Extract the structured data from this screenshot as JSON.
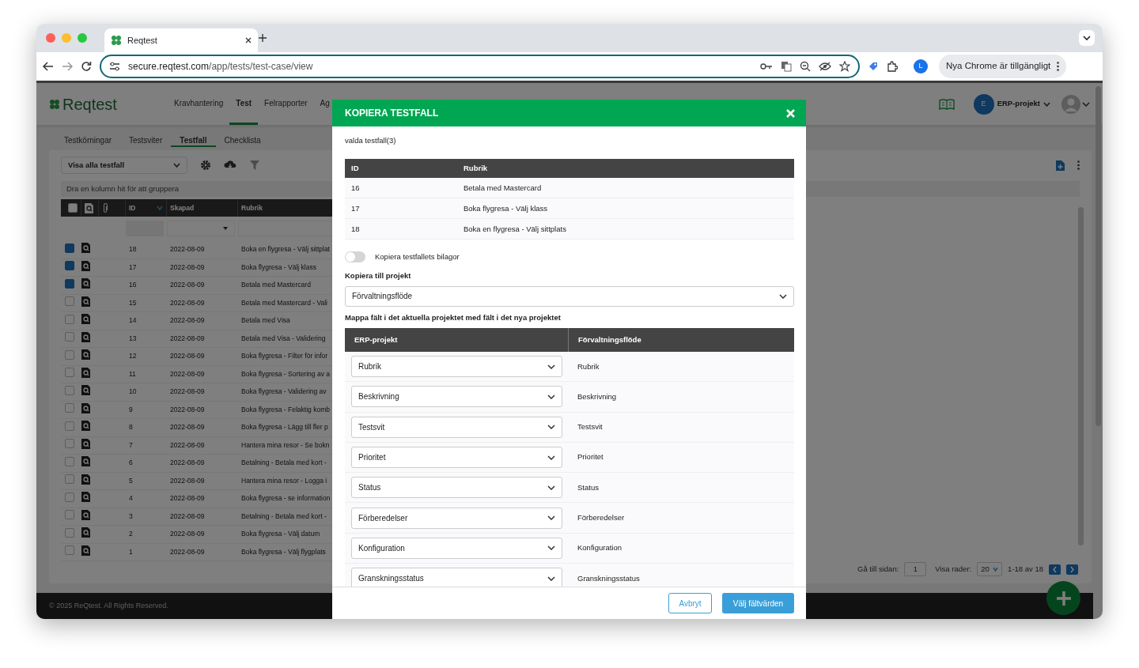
{
  "browser": {
    "tab_title": "Reqtest",
    "url_host": "secure.reqtest.com",
    "url_path": "/app/tests/test-case/view",
    "profile_initial": "L",
    "update_button": "Nya Chrome är tillgängligt"
  },
  "app": {
    "logo": "Reqtest",
    "nav": [
      {
        "label": "Kravhantering",
        "selected": false
      },
      {
        "label": "Test",
        "selected": true
      },
      {
        "label": "Felrapporter",
        "selected": false
      },
      {
        "label": "Ag",
        "selected": false
      }
    ],
    "project": {
      "initial": "E",
      "name": "ERP-projekt"
    },
    "subtabs": [
      {
        "label": "Testkörningar",
        "selected": false
      },
      {
        "label": "Testsviter",
        "selected": false
      },
      {
        "label": "Testfall",
        "selected": true
      },
      {
        "label": "Checklista",
        "selected": false
      }
    ],
    "view_select": "Visa alla testfall",
    "group_hint": "Dra en kolumn hit för att gruppera",
    "columns": [
      "ID",
      "Skapad",
      "Rubrik"
    ],
    "all_selected": false,
    "rows": [
      {
        "selected": true,
        "id": "18",
        "created": "2022-08-09",
        "title": "Boka en flygresa - Välj sittplat"
      },
      {
        "selected": true,
        "id": "17",
        "created": "2022-08-09",
        "title": "Boka flygresa - Välj klass"
      },
      {
        "selected": true,
        "id": "16",
        "created": "2022-08-09",
        "title": "Betala med Mastercard"
      },
      {
        "selected": false,
        "id": "15",
        "created": "2022-08-09",
        "title": "Betala med Mastercard - Vali"
      },
      {
        "selected": false,
        "id": "14",
        "created": "2022-08-09",
        "title": "Betala med Visa"
      },
      {
        "selected": false,
        "id": "13",
        "created": "2022-08-09",
        "title": "Betala med Visa - Validering"
      },
      {
        "selected": false,
        "id": "12",
        "created": "2022-08-09",
        "title": "Boka flygresa - Filter för infor"
      },
      {
        "selected": false,
        "id": "11",
        "created": "2022-08-09",
        "title": "Boka flygresa - Sortering av a"
      },
      {
        "selected": false,
        "id": "10",
        "created": "2022-08-09",
        "title": "Boka flygresa - Validering av"
      },
      {
        "selected": false,
        "id": "9",
        "created": "2022-08-09",
        "title": "Boka flygresa - Felaktig komb"
      },
      {
        "selected": false,
        "id": "8",
        "created": "2022-08-09",
        "title": "Boka flygresa - Lägg till fler p"
      },
      {
        "selected": false,
        "id": "7",
        "created": "2022-08-09",
        "title": "Hantera mina resor - Se bokn"
      },
      {
        "selected": false,
        "id": "6",
        "created": "2022-08-09",
        "title": "Betalning - Betala med kort -"
      },
      {
        "selected": false,
        "id": "5",
        "created": "2022-08-09",
        "title": "Hantera mina resor - Logga i"
      },
      {
        "selected": false,
        "id": "4",
        "created": "2022-08-09",
        "title": "Boka flygresa - se information"
      },
      {
        "selected": false,
        "id": "3",
        "created": "2022-08-09",
        "title": "Betalning - Betala med kort -"
      },
      {
        "selected": false,
        "id": "2",
        "created": "2022-08-09",
        "title": "Boka flygresa - Välj datum"
      },
      {
        "selected": false,
        "id": "1",
        "created": "2022-08-09",
        "title": "Boka flygresa - Välj flygplats"
      }
    ],
    "pagination": {
      "goto_label": "Gå till sidan:",
      "page": "1",
      "rows_label": "Visa rader:",
      "rows_value": "20",
      "range": "1-18 av 18"
    },
    "footer": "© 2025 ReQtest. All Rights Reserved."
  },
  "modal": {
    "title": "KOPIERA TESTFALL",
    "selected_label": "valda testfall(3)",
    "columns": [
      "ID",
      "Rubrik"
    ],
    "rows": [
      {
        "id": "16",
        "title": "Betala med Mastercard"
      },
      {
        "id": "17",
        "title": "Boka flygresa - Välj klass"
      },
      {
        "id": "18",
        "title": "Boka en flygresa - Välj sittplats"
      }
    ],
    "attachments_toggle": {
      "label": "Kopiera testfallets bilagor",
      "on": false
    },
    "project_label": "Kopiera till projekt",
    "project_value": "Förvaltningsflöde",
    "mapping_label": "Mappa fält i det aktuella projektet med fält i det nya projektet",
    "mapping_columns": [
      "ERP-projekt",
      "Förvaltningsflöde"
    ],
    "mappings": [
      {
        "source": "Rubrik",
        "target": "Rubrik"
      },
      {
        "source": "Beskrivning",
        "target": "Beskrivning"
      },
      {
        "source": "Testsvit",
        "target": "Testsvit"
      },
      {
        "source": "Prioritet",
        "target": "Prioritet"
      },
      {
        "source": "Status",
        "target": "Status"
      },
      {
        "source": "Förberedelser",
        "target": "Förberedelser"
      },
      {
        "source": "Konfiguration",
        "target": "Konfiguration"
      },
      {
        "source": "Granskningsstatus",
        "target": "Granskningsstatus"
      }
    ],
    "cancel_button": "Avbryt",
    "confirm_button": "Välj fältvärden"
  }
}
